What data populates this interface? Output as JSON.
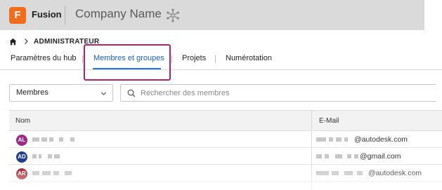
{
  "header": {
    "logo_letter": "F",
    "app_name": "Fusion",
    "company_name": "Company Name",
    "hub_icon": "hub-network-icon",
    "brand_color": "#f26c1d"
  },
  "breadcrumb": {
    "home_icon": "home-icon",
    "label": "ADMINISTRATEUR"
  },
  "tabs": [
    {
      "label": "Paramètres du hub",
      "active": false
    },
    {
      "label": "Membres et groupes",
      "active": true
    },
    {
      "label": "Projets",
      "active": false
    },
    {
      "label": "Numérotation",
      "active": false
    }
  ],
  "filter": {
    "selected": "Membres",
    "search_placeholder": "Rechercher des membres"
  },
  "table": {
    "columns": [
      "Nom",
      "E-Mail"
    ],
    "rows": [
      {
        "initials": "AL",
        "avatar_color": "#9b2a8c",
        "email_domain": "@autodesk.com"
      },
      {
        "initials": "AD",
        "avatar_color": "#1e3f8f",
        "email_domain": "@gmail.com"
      },
      {
        "initials": "AR",
        "avatar_color": "#a2202f",
        "email_domain": "@autodesk.com"
      }
    ]
  }
}
